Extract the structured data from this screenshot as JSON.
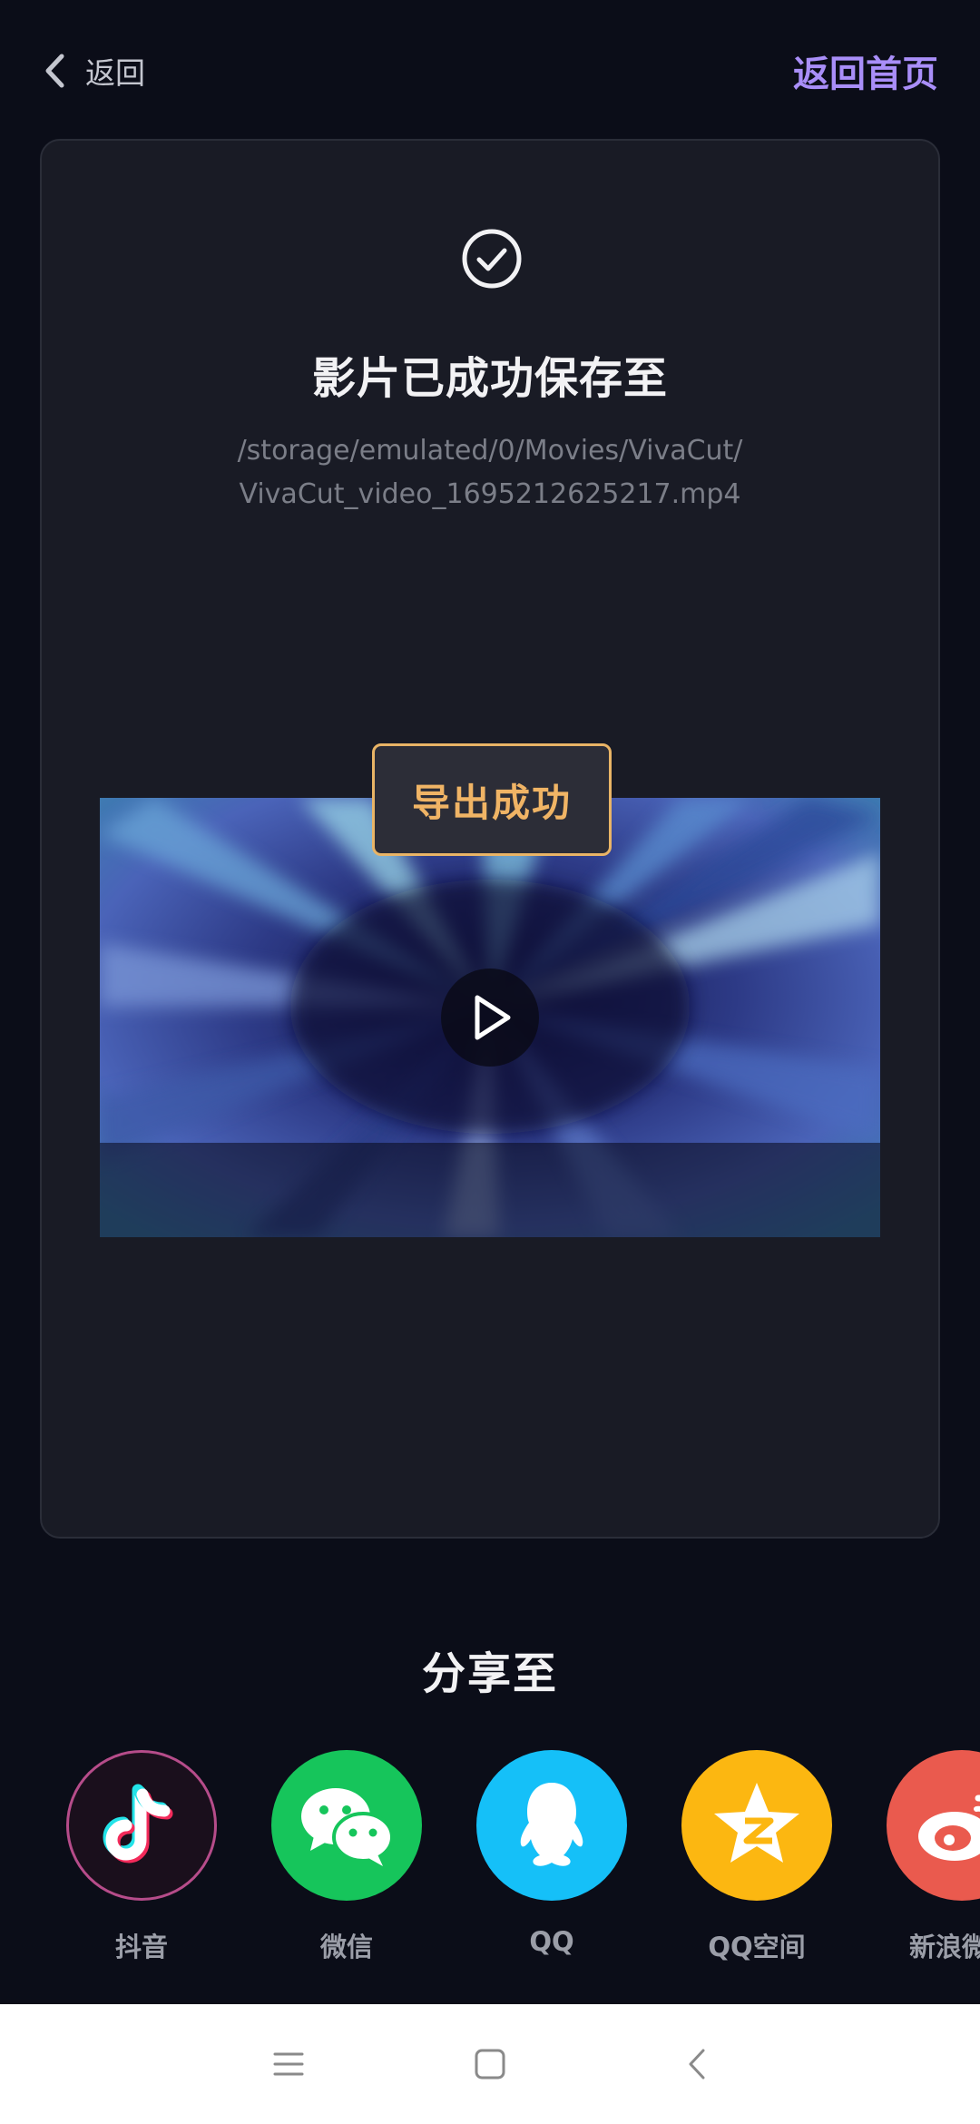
{
  "header": {
    "back_label": "返回",
    "home_label": "返回首页"
  },
  "result": {
    "title": "影片已成功保存至",
    "path_line1": "/storage/emulated/0/Movies/VivaCut/",
    "path_line2": "VivaCut_video_1695212625217.mp4",
    "toast": "导出成功"
  },
  "share": {
    "title": "分享至",
    "targets": [
      {
        "label": "抖音",
        "icon": "douyin-icon",
        "color": "#1a0f1c"
      },
      {
        "label": "微信",
        "icon": "wechat-icon",
        "color": "#16c55b"
      },
      {
        "label": "QQ",
        "icon": "qq-icon",
        "color": "#15c0f8"
      },
      {
        "label": "QQ空间",
        "icon": "qzone-icon",
        "color": "#fcb711"
      },
      {
        "label": "新浪微博",
        "icon": "weibo-icon",
        "color": "#ea5a4e"
      }
    ]
  },
  "colors": {
    "background": "#0b0d18",
    "card": "#191b25",
    "accent": "#a98ef8",
    "toast_border": "#e9b466",
    "toast_text": "#f0b465"
  },
  "system_nav": {
    "buttons": [
      "menu-icon",
      "home-square-icon",
      "back-chevron-icon"
    ]
  }
}
